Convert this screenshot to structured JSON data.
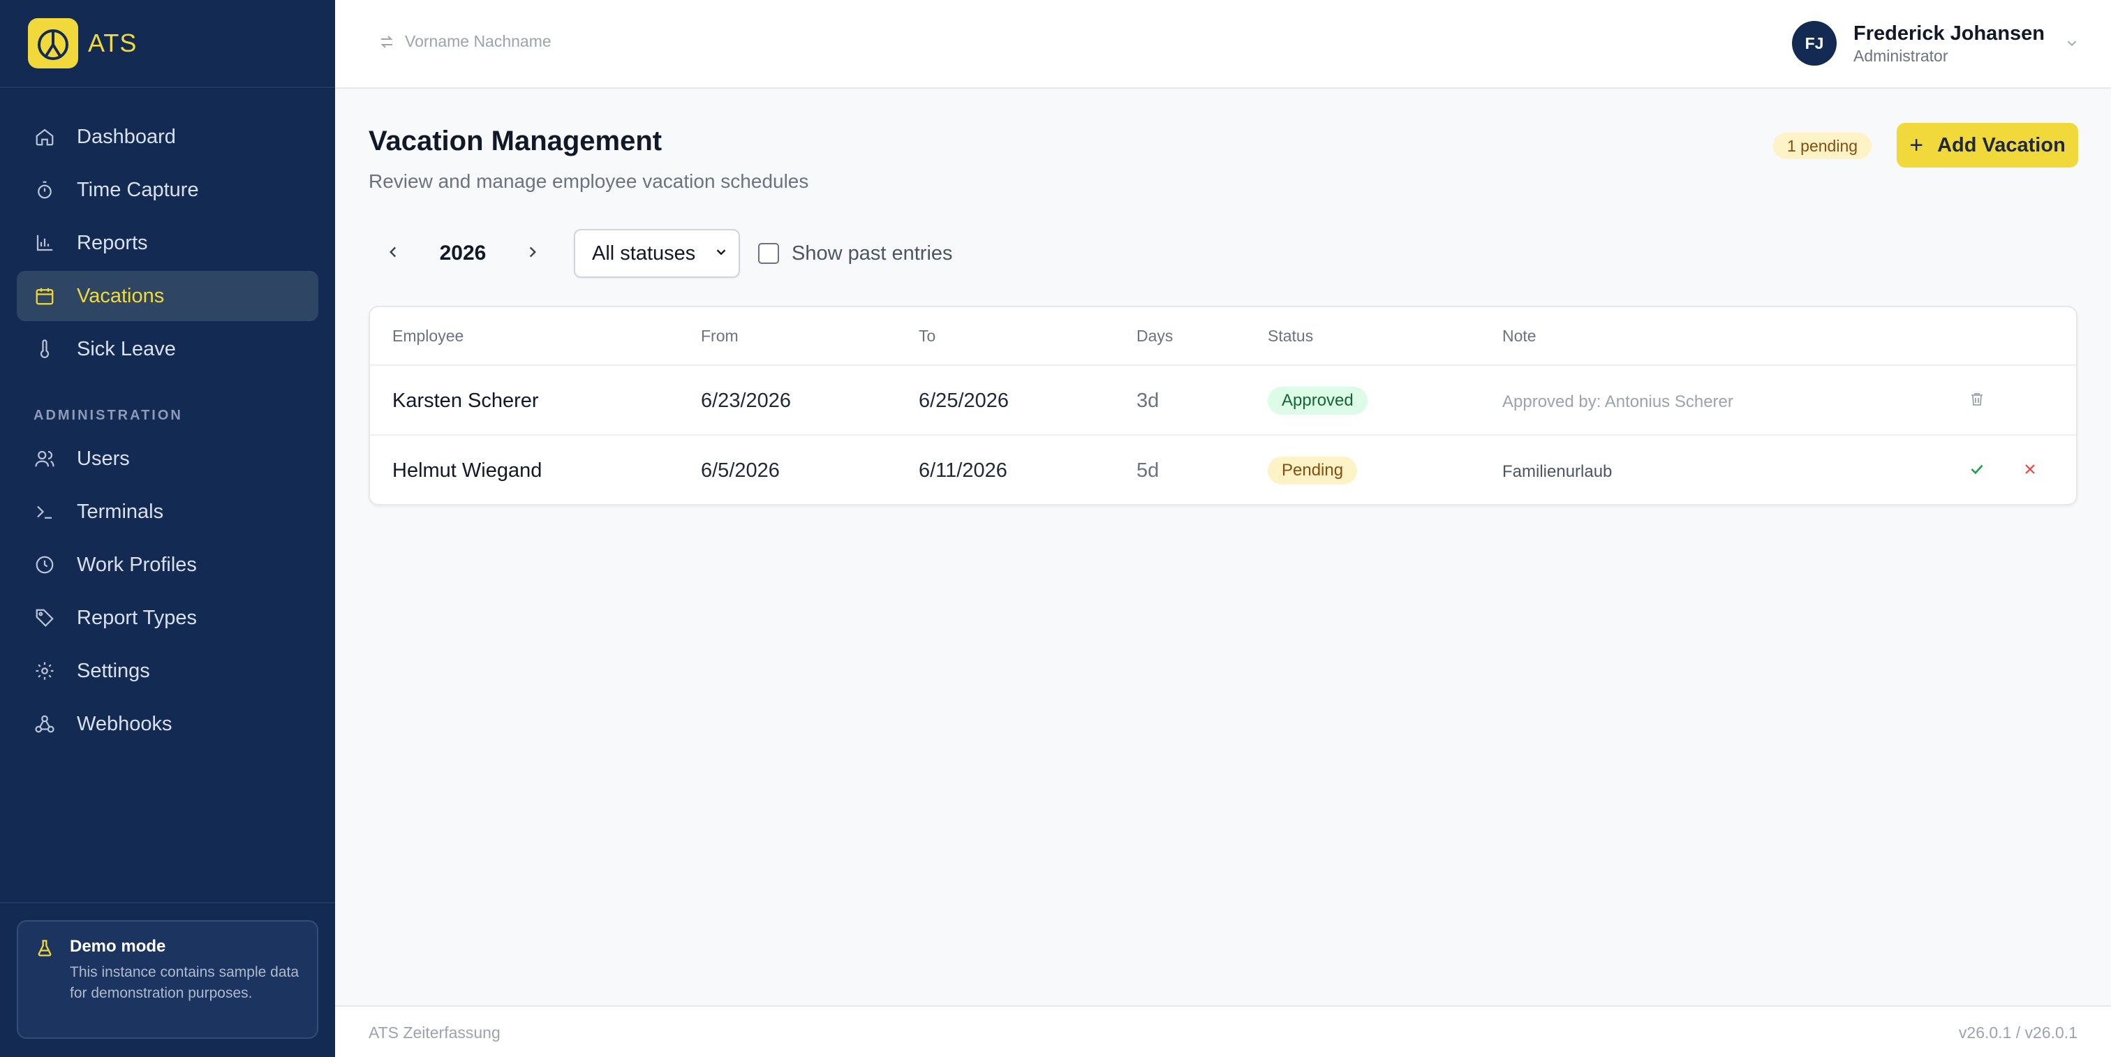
{
  "brand": {
    "name": "ATS"
  },
  "sidebar": {
    "items": [
      {
        "label": "Dashboard",
        "icon": "home-icon"
      },
      {
        "label": "Time Capture",
        "icon": "stopwatch-icon"
      },
      {
        "label": "Reports",
        "icon": "bar-chart-icon"
      },
      {
        "label": "Vacations",
        "icon": "calendar-icon",
        "active": true
      },
      {
        "label": "Sick Leave",
        "icon": "thermometer-icon"
      }
    ],
    "admin_section": "ADMINISTRATION",
    "admin_items": [
      {
        "label": "Users",
        "icon": "users-icon"
      },
      {
        "label": "Terminals",
        "icon": "terminal-icon"
      },
      {
        "label": "Work Profiles",
        "icon": "clock-icon"
      },
      {
        "label": "Report Types",
        "icon": "tag-icon"
      },
      {
        "label": "Settings",
        "icon": "gear-icon"
      },
      {
        "label": "Webhooks",
        "icon": "webhook-icon"
      }
    ],
    "demo": {
      "title": "Demo mode",
      "text": "This instance contains sample data for demonstration purposes."
    }
  },
  "topbar": {
    "switcher_placeholder": "Vorname Nachname",
    "user": {
      "initials": "FJ",
      "name": "Frederick Johansen",
      "role": "Administrator"
    }
  },
  "main": {
    "title": "Vacation Management",
    "subtitle": "Review and manage employee vacation schedules",
    "pending_badge": "1 pending",
    "add_button": "Add Vacation",
    "year": "2026",
    "status_filter": "All statuses",
    "show_past_label": "Show past entries",
    "show_past_checked": false
  },
  "table": {
    "columns": [
      "Employee",
      "From",
      "To",
      "Days",
      "Status",
      "Note"
    ],
    "rows": [
      {
        "employee": "Karsten Scherer",
        "from": "6/23/2026",
        "to": "6/25/2026",
        "days": "3d",
        "status": "Approved",
        "note": "Approved by: Antonius Scherer"
      },
      {
        "employee": "Helmut Wiegand",
        "from": "6/5/2026",
        "to": "6/11/2026",
        "days": "5d",
        "status": "Pending",
        "note": "Familienurlaub"
      }
    ]
  },
  "footer": {
    "left": "ATS Zeiterfassung",
    "right": "v26.0.1 / v26.0.1"
  },
  "colors": {
    "sidebar": "#132a52",
    "accent": "#f2d93b",
    "approved": "#dcfce7",
    "pending": "#fef3c7"
  }
}
